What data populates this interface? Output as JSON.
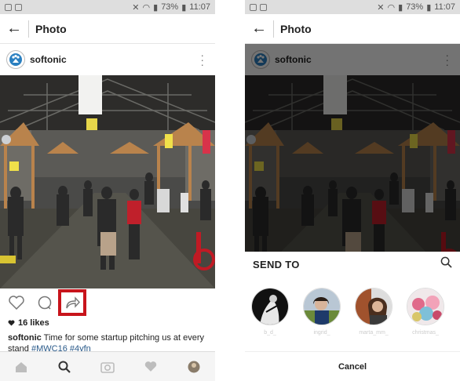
{
  "status": {
    "percent": "73%",
    "time": "11:07"
  },
  "header": {
    "title": "Photo"
  },
  "post": {
    "username": "softonic",
    "likes": "16 likes",
    "caption_user": "softonic",
    "caption_text": "Time for some startup pitching us at every stand",
    "caption_tags": "#MWC16 #4yfn"
  },
  "share_sheet": {
    "title": "SEND TO",
    "cancel_label": "Cancel",
    "contacts": [
      {
        "name": "b_d_",
        "avatar": "bw-photo"
      },
      {
        "name": "ingrid_",
        "avatar": "woman-photo"
      },
      {
        "name": "marta_mm_",
        "avatar": "woman-portrait"
      },
      {
        "name": "christmas_",
        "avatar": "cupcake-photo"
      }
    ]
  },
  "colors": {
    "highlight": "#c8141b",
    "hashtag": "#2a5a8a"
  }
}
